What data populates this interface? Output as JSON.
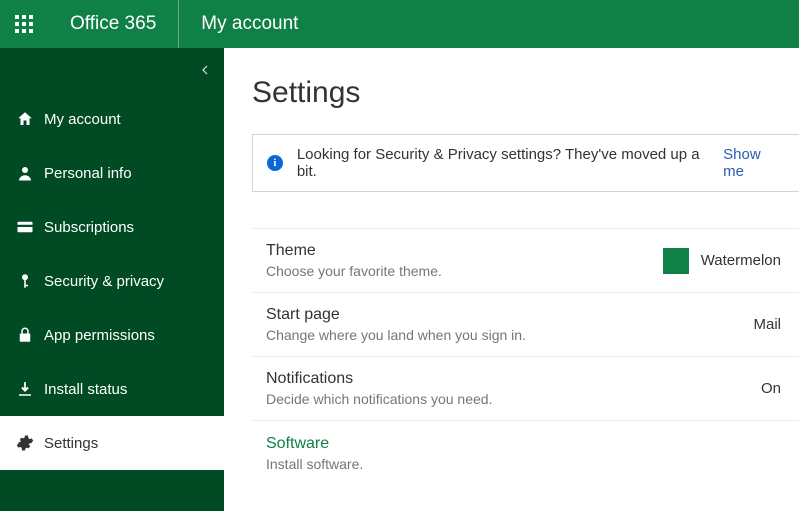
{
  "header": {
    "brand": "Office 365",
    "subtitle": "My account"
  },
  "sidebar": {
    "items": [
      {
        "label": "My account"
      },
      {
        "label": "Personal info"
      },
      {
        "label": "Subscriptions"
      },
      {
        "label": "Security & privacy"
      },
      {
        "label": "App permissions"
      },
      {
        "label": "Install status"
      },
      {
        "label": "Settings"
      }
    ]
  },
  "page": {
    "title": "Settings",
    "info": {
      "text": "Looking for Security & Privacy settings? They've moved up a bit.",
      "link": "Show me"
    },
    "rows": {
      "theme": {
        "title": "Theme",
        "desc": "Choose your favorite theme.",
        "value": "Watermelon",
        "swatch": "#0f8046"
      },
      "start": {
        "title": "Start page",
        "desc": "Change where you land when you sign in.",
        "value": "Mail"
      },
      "notifications": {
        "title": "Notifications",
        "desc": "Decide which notifications you need.",
        "value": "On"
      },
      "software": {
        "title": "Software",
        "desc": "Install software."
      }
    }
  }
}
